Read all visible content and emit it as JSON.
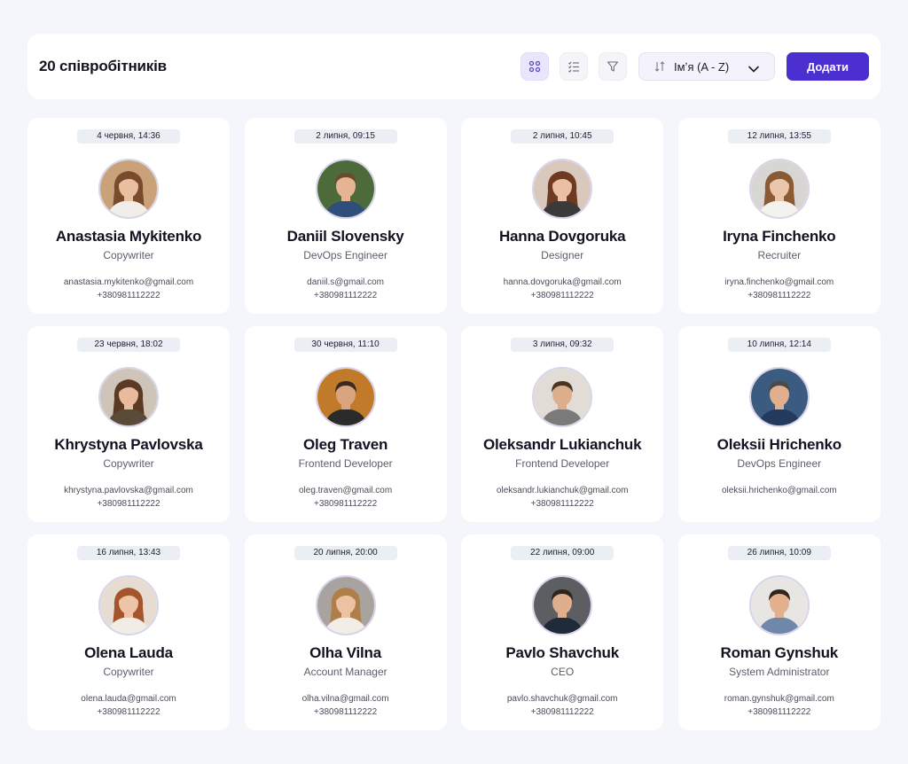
{
  "header": {
    "title": "20 співробітників",
    "sort_label": "Імʼя (A - Z)",
    "add_label": "Додати"
  },
  "employees": [
    {
      "date": "4 червня, 14:36",
      "name": "Anastasia Mykitenko",
      "role": "Copywriter",
      "email": "anastasia.mykitenko@gmail.com",
      "phone": "+380981112222",
      "skin": "#e9bfa0",
      "hair": "#7a4a2c",
      "shirt": "#f1eee9",
      "bg": "#c9a27a",
      "long_hair": true
    },
    {
      "date": "2 липня, 09:15",
      "name": "Daniil Slovensky",
      "role": "DevOps Engineer",
      "email": "daniil.s@gmail.com",
      "phone": "+380981112222",
      "skin": "#e4b493",
      "hair": "#6b4a2e",
      "shirt": "#2f4f7a",
      "bg": "#4d6b3a",
      "long_hair": false
    },
    {
      "date": "2 липня, 10:45",
      "name": "Hanna Dovgoruka",
      "role": "Designer",
      "email": "hanna.dovgoruka@gmail.com",
      "phone": "+380981112222",
      "skin": "#eabfa3",
      "hair": "#6e3a22",
      "shirt": "#3a3a3a",
      "bg": "#d9c9bd",
      "long_hair": true
    },
    {
      "date": "12 липня, 13:55",
      "name": "Iryna Finchenko",
      "role": "Recruiter",
      "email": "iryna.finchenko@gmail.com",
      "phone": "+380981112222",
      "skin": "#ecc6ab",
      "hair": "#8a5a35",
      "shirt": "#f4f2ee",
      "bg": "#d8d6d2",
      "long_hair": true
    },
    {
      "date": "23 червня, 18:02",
      "name": "Khrystyna Pavlovska",
      "role": "Copywriter",
      "email": "khrystyna.pavlovska@gmail.com",
      "phone": "+380981112222",
      "skin": "#e7bb9c",
      "hair": "#5a3a24",
      "shirt": "#5a4a3a",
      "bg": "#cfc4b8",
      "long_hair": true
    },
    {
      "date": "30 червня, 11:10",
      "name": "Oleg Traven",
      "role": "Frontend Developer",
      "email": "oleg.traven@gmail.com",
      "phone": "+380981112222",
      "skin": "#d9a47e",
      "hair": "#3b2a1e",
      "shirt": "#2b2b2b",
      "bg": "#c07a2a",
      "long_hair": false
    },
    {
      "date": "3 липня, 09:32",
      "name": "Oleksandr Lukianchuk",
      "role": "Frontend Developer",
      "email": "oleksandr.lukianchuk@gmail.com",
      "phone": "+380981112222",
      "skin": "#dcae8c",
      "hair": "#4a3424",
      "shirt": "#7a7a7a",
      "bg": "#e2dcd6",
      "long_hair": false
    },
    {
      "date": "10 липня, 12:14",
      "name": "Oleksii Hrichenko",
      "role": "DevOps Engineer",
      "email": "oleksii.hrichenko@gmail.com",
      "phone": "",
      "skin": "#e0b08e",
      "hair": "#4a4a4a",
      "shirt": "#233a5e",
      "bg": "#3b5c80",
      "long_hair": false
    },
    {
      "date": "16 липня, 13:43",
      "name": "Olena Lauda",
      "role": "Copywriter",
      "email": "olena.lauda@gmail.com",
      "phone": "+380981112222",
      "skin": "#eec4a6",
      "hair": "#a4552c",
      "shirt": "#f1ece6",
      "bg": "#e6dcd2",
      "long_hair": true
    },
    {
      "date": "20 липня, 20:00",
      "name": "Olha Vilna",
      "role": "Account Manager",
      "email": "olha.vilna@gmail.com",
      "phone": "+380981112222",
      "skin": "#ecc3a2",
      "hair": "#b07e48",
      "shirt": "#f2ede6",
      "bg": "#a9a3a0",
      "long_hair": true
    },
    {
      "date": "22 липня, 09:00",
      "name": "Pavlo Shavchuk",
      "role": "CEO",
      "email": "pavlo.shavchuk@gmail.com",
      "phone": "+380981112222",
      "skin": "#dfae8c",
      "hair": "#2d241e",
      "shirt": "#1f2a3a",
      "bg": "#5d5e62",
      "long_hair": false
    },
    {
      "date": "26 липня, 10:09",
      "name": "Roman Gynshuk",
      "role": "System Administrator",
      "email": "roman.gynshuk@gmail.com",
      "phone": "+380981112222",
      "skin": "#e2b08d",
      "hair": "#2e2420",
      "shirt": "#6f87a8",
      "bg": "#e8e6e2",
      "long_hair": false
    }
  ]
}
